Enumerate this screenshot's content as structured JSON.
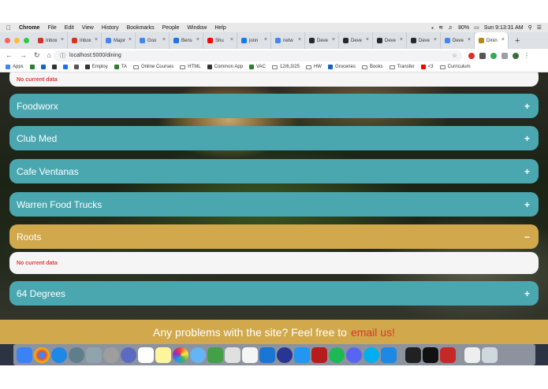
{
  "menubar": {
    "app": "Chrome",
    "items": [
      "File",
      "Edit",
      "View",
      "History",
      "Bookmarks",
      "People",
      "Window",
      "Help"
    ],
    "battery": "80%",
    "clock": "Sun 9:13:31 AM"
  },
  "tabs": [
    {
      "label": "Inbox",
      "color": "#d93025"
    },
    {
      "label": "Inbox",
      "color": "#d93025"
    },
    {
      "label": "Major",
      "color": "#4285f4"
    },
    {
      "label": "Goo",
      "color": "#4285f4"
    },
    {
      "label": "Bens",
      "color": "#1a73e8"
    },
    {
      "label": "Shu",
      "color": "#ff0000"
    },
    {
      "label": "jonn",
      "color": "#1877f2"
    },
    {
      "label": "netw",
      "color": "#4285f4"
    },
    {
      "label": "Deve",
      "color": "#24292e"
    },
    {
      "label": "Deve",
      "color": "#24292e"
    },
    {
      "label": "Deve",
      "color": "#24292e"
    },
    {
      "label": "Deve",
      "color": "#24292e"
    },
    {
      "label": "Deve",
      "color": "#4285f4"
    },
    {
      "label": "Dinin",
      "color": "#b8860b"
    }
  ],
  "address": {
    "url": "localhost:5000/dining"
  },
  "bookmarks": [
    {
      "label": "Apps"
    },
    {
      "label": ""
    },
    {
      "label": ""
    },
    {
      "label": ""
    },
    {
      "label": ""
    },
    {
      "label": ""
    },
    {
      "label": "Employ"
    },
    {
      "label": "TA"
    },
    {
      "label": "Online Courses"
    },
    {
      "label": "HTML"
    },
    {
      "label": "Common App"
    },
    {
      "label": "VAC"
    },
    {
      "label": "12/6,3/25"
    },
    {
      "label": "HW"
    },
    {
      "label": "Groceries"
    },
    {
      "label": "Books"
    },
    {
      "label": "Transfer"
    },
    {
      "label": "<3"
    },
    {
      "label": "Curriculum"
    }
  ],
  "page": {
    "top_empty": "No current data",
    "halls": [
      {
        "name": "Foodworx",
        "sign": "+"
      },
      {
        "name": "Club Med",
        "sign": "+"
      },
      {
        "name": "Cafe Ventanas",
        "sign": "+"
      },
      {
        "name": "Warren Food Trucks",
        "sign": "+"
      },
      {
        "name": "Roots",
        "sign": "−"
      },
      {
        "name": "64 Degrees",
        "sign": "+"
      }
    ],
    "roots_empty": "No current data",
    "footer_text": "Any problems with the site? Feel free to",
    "footer_link": "email us!"
  },
  "colors": {
    "teal": "#4aa7b0",
    "gold": "#d1a94c",
    "error": "#e03d3d"
  }
}
